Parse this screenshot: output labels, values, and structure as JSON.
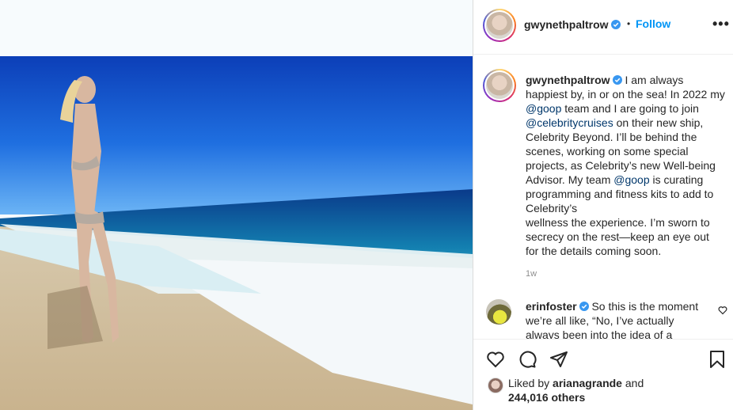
{
  "post": {
    "author": "gwynethpaltrow",
    "follow_label": "Follow",
    "separator": "•",
    "more_label": "•••"
  },
  "caption": {
    "author": "gwynethpaltrow",
    "part1": " I am always happiest by, in or on the sea! In 2022 my ",
    "mention1": "@goop",
    "part2": " team and I are going to join ",
    "mention2": "@celebritycruises",
    "part3": " on their new ship, Celebrity Beyond. I’ll be behind the scenes, working on some special projects, as Celebrity’s new Well-being Advisor. My team ",
    "mention3": "@goop",
    "part4": " is curating programming and fitness kits to add to Celebrity’s",
    "part5": "wellness the experience. I’m  sworn to secrecy on the rest—keep an eye out for the details coming soon.",
    "time": "1w"
  },
  "comment": {
    "author": "erinfoster",
    "text": " So this is the moment we’re all like, “No, I’ve actually always been into the idea of a"
  },
  "likes": {
    "prefix": "Liked by ",
    "user": "arianagrande",
    "mid": " and",
    "count": "244,016 others"
  },
  "colors": {
    "link": "#0095f6",
    "mention": "#00376b",
    "verified": "#3897f0"
  },
  "icons": [
    "verified-badge-icon",
    "more-options-icon",
    "heart-icon",
    "comment-icon",
    "share-icon",
    "bookmark-icon"
  ]
}
